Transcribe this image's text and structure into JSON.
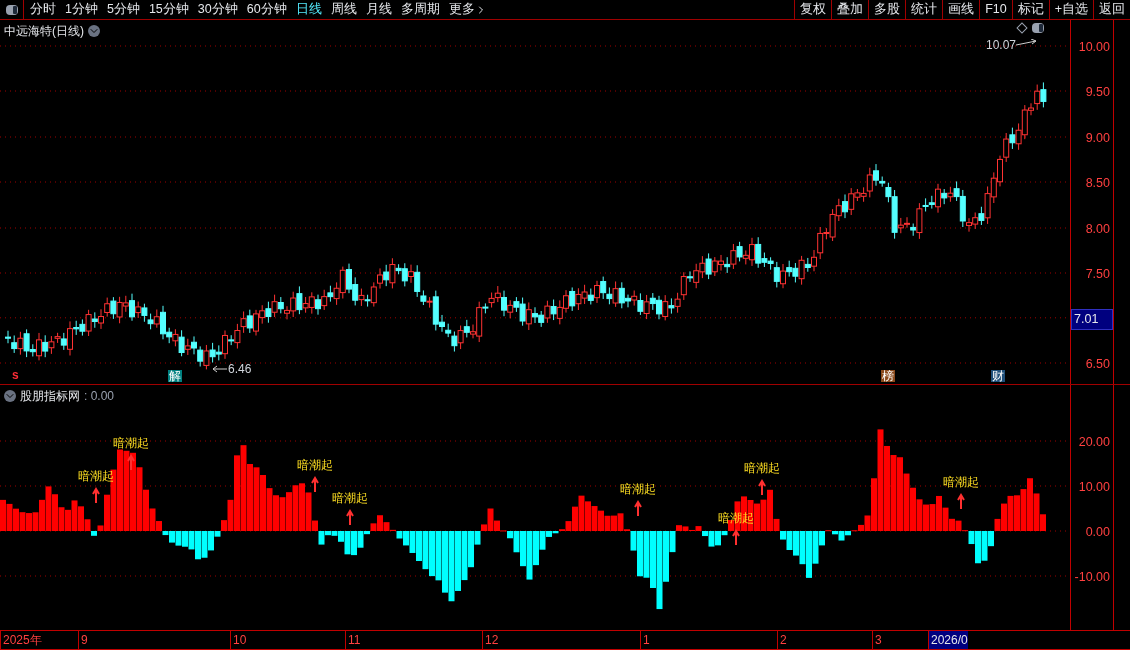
{
  "toolbar": {
    "periods": [
      {
        "label": "分时",
        "selected": false
      },
      {
        "label": "1分钟",
        "selected": false
      },
      {
        "label": "5分钟",
        "selected": false
      },
      {
        "label": "15分钟",
        "selected": false
      },
      {
        "label": "30分钟",
        "selected": false
      },
      {
        "label": "60分钟",
        "selected": false
      },
      {
        "label": "日线",
        "selected": true
      },
      {
        "label": "周线",
        "selected": false
      },
      {
        "label": "月线",
        "selected": false
      },
      {
        "label": "多周期",
        "selected": false
      },
      {
        "label": "更多",
        "selected": false
      }
    ],
    "actions": [
      "复权",
      "叠加",
      "多股",
      "统计",
      "画线",
      "F10",
      "标记",
      "+自选",
      "返回"
    ]
  },
  "main_chart": {
    "title": "中远海特(日线)",
    "y_labels": [
      "10.00",
      "9.50",
      "9.00",
      "8.50",
      "8.00",
      "7.50",
      "6.50"
    ],
    "high_label": "10.07",
    "low_label": "6.46",
    "last_price": "7.01",
    "signal": "s",
    "markers": [
      {
        "text": "解",
        "color": "#008080"
      },
      {
        "text": "榜",
        "color": "#8b4a1c"
      },
      {
        "text": "财",
        "color": "#1f4f7a"
      }
    ]
  },
  "indicator": {
    "title": "股朋指标网",
    "value": ": 0.00",
    "y_labels": [
      "20.00",
      "10.00",
      "0.00",
      "-10.00"
    ],
    "signals": [
      "暗潮起",
      "暗潮起",
      "暗潮起",
      "暗潮起",
      "暗潮起",
      "暗潮起",
      "暗潮起",
      "暗潮起"
    ]
  },
  "date_axis": [
    "2025年",
    "9",
    "10",
    "11",
    "12",
    "1",
    "2",
    "3",
    "2026/0"
  ]
}
